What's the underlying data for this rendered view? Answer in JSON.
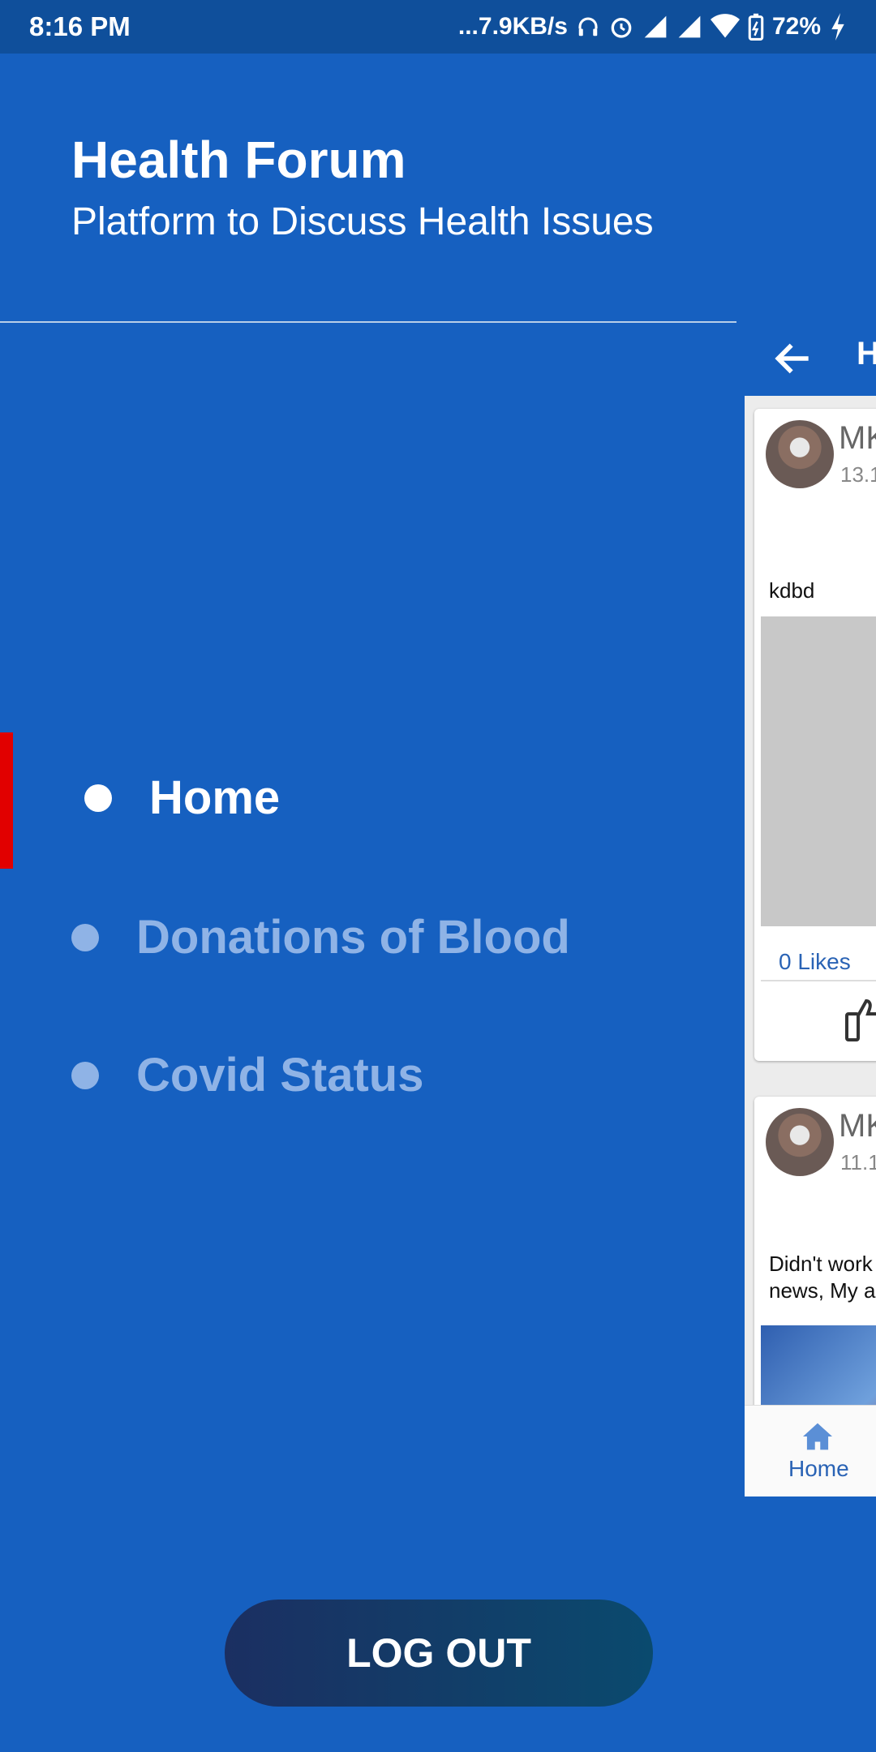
{
  "status_bar": {
    "time": "8:16 PM",
    "network_speed": "...7.9KB/s",
    "battery": "72%",
    "icons": [
      "headset-icon",
      "alarm-icon",
      "signal-icon",
      "signal-icon",
      "wifi-icon",
      "battery-icon",
      "charging-icon"
    ]
  },
  "drawer": {
    "title": "Health Forum",
    "subtitle": "Platform to Discuss Health Issues",
    "menu": [
      {
        "label": "Home",
        "active": true
      },
      {
        "label": "Donations of Blood",
        "active": false
      },
      {
        "label": "Covid Status",
        "active": false
      }
    ],
    "logout_label": "LOG OUT"
  },
  "main_screen": {
    "toolbar_title_partial": "H",
    "posts": [
      {
        "user_partial": "MK",
        "date_partial": "13.1",
        "text": "kdbd",
        "likes": "0 Likes"
      },
      {
        "user_partial": "MK",
        "date_partial": "11.1",
        "text": "Didn't work news, My a"
      }
    ],
    "bottom_nav": {
      "label": "Home"
    }
  },
  "colors": {
    "drawer_bg": "#1660c0",
    "status_bar_bg": "#0f4f9b",
    "active_indicator": "#e10000",
    "inactive_text": "#8fb3e6"
  }
}
